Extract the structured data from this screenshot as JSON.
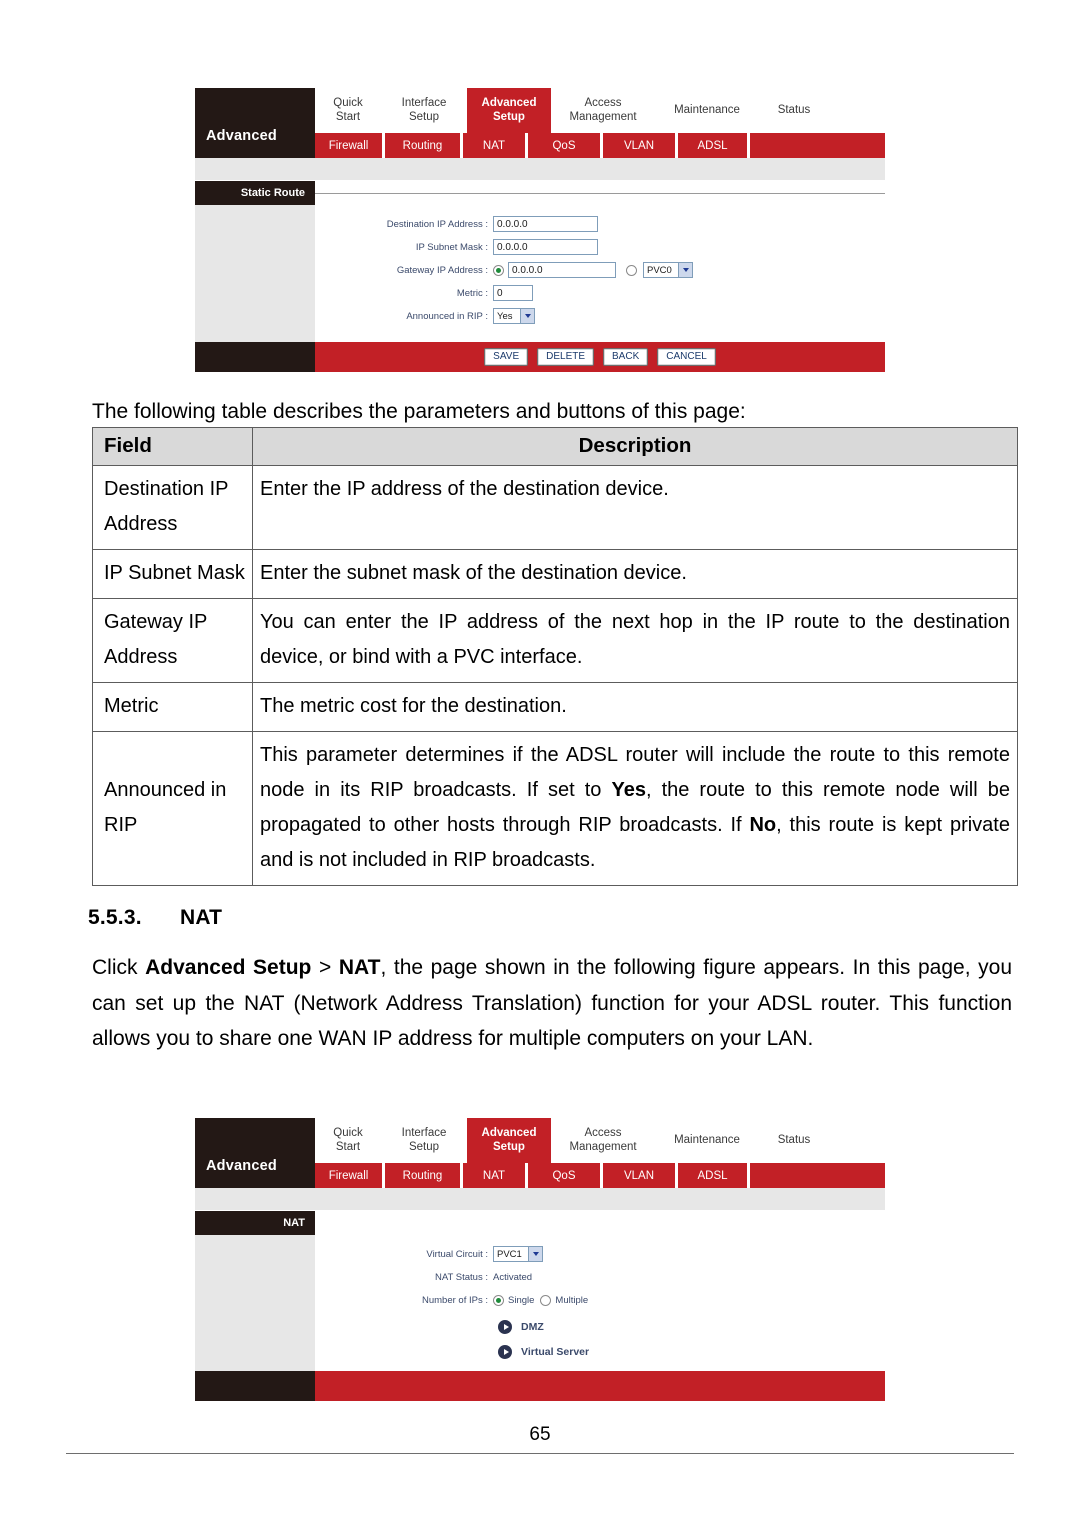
{
  "router_ui_static_route": {
    "brand_label": "Advanced",
    "main_tabs": [
      {
        "line1": "Quick",
        "line2": "Start"
      },
      {
        "line1": "Interface",
        "line2": "Setup"
      },
      {
        "line1": "Advanced",
        "line2": "Setup"
      },
      {
        "line1": "Access",
        "line2": "Management"
      },
      {
        "line1": "Maintenance",
        "line2": ""
      },
      {
        "line1": "Status",
        "line2": ""
      }
    ],
    "sub_tabs": [
      "Firewall",
      "Routing",
      "NAT",
      "QoS",
      "VLAN",
      "ADSL"
    ],
    "section_label": "Static Route",
    "fields": {
      "destination_ip_label": "Destination IP Address :",
      "destination_ip_value": "0.0.0.0",
      "subnet_mask_label": "IP Subnet Mask :",
      "subnet_mask_value": "0.0.0.0",
      "gateway_label": "Gateway IP Address :",
      "gateway_value": "0.0.0.0",
      "gateway_pvc_value": "PVC0",
      "metric_label": "Metric :",
      "metric_value": "0",
      "announced_label": "Announced in RIP :",
      "announced_value": "Yes"
    },
    "buttons": [
      "SAVE",
      "DELETE",
      "BACK",
      "CANCEL"
    ]
  },
  "intro_line": "The following table describes the parameters and buttons of this page:",
  "param_table": {
    "headers": [
      "Field",
      "Description"
    ],
    "rows": [
      {
        "field": "Destination IP Address",
        "description": "Enter the IP address of the destination device."
      },
      {
        "field": "IP Subnet Mask",
        "description": "Enter the subnet mask of the destination device."
      },
      {
        "field": "Gateway IP Address",
        "description": "You can enter the IP address of the next hop in the IP route to the destination device, or bind with a PVC interface."
      },
      {
        "field": "Metric",
        "description": "The metric cost for the destination."
      },
      {
        "field": "Announced in RIP",
        "description": "This parameter determines if the ADSL router will include the route to this remote node in its RIP broadcasts. If set to Yes, the route to this remote node will be propagated to other hosts through RIP broadcasts. If No, this route is kept private and is not included in RIP broadcasts."
      }
    ]
  },
  "section": {
    "number": "5.5.3.",
    "title": "NAT"
  },
  "nat_paragraph": {
    "p1": "Click ",
    "bold1": "Advanced Setup",
    "p2": " > ",
    "bold2": "NAT",
    "p3": ", the page shown in the following figure appears. In this page, you can set up the NAT (Network Address Translation) function for your ADSL router. This function allows you to share one WAN IP address for multiple computers on your LAN."
  },
  "router_ui_nat": {
    "brand_label": "Advanced",
    "main_tabs": [
      {
        "line1": "Quick",
        "line2": "Start"
      },
      {
        "line1": "Interface",
        "line2": "Setup"
      },
      {
        "line1": "Advanced",
        "line2": "Setup"
      },
      {
        "line1": "Access",
        "line2": "Management"
      },
      {
        "line1": "Maintenance",
        "line2": ""
      },
      {
        "line1": "Status",
        "line2": ""
      }
    ],
    "sub_tabs": [
      "Firewall",
      "Routing",
      "NAT",
      "QoS",
      "VLAN",
      "ADSL"
    ],
    "section_label": "NAT",
    "fields": {
      "virtual_circuit_label": "Virtual Circuit :",
      "virtual_circuit_value": "PVC1",
      "nat_status_label": "NAT Status :",
      "nat_status_value": "Activated",
      "number_of_ips_label": "Number of IPs :",
      "option_single": "Single",
      "option_multiple": "Multiple"
    },
    "links": [
      "DMZ",
      "Virtual Server"
    ]
  },
  "page_number": "65",
  "colors": {
    "brand_red": "#c22026",
    "dark_bar": "#231815",
    "sidebar_gray": "#e7e7e7",
    "table_header_gray": "#d9d9d9"
  }
}
